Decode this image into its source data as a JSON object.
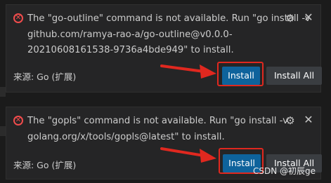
{
  "notifications": [
    {
      "message_lines": [
        "The \"go-outline\" command is not available. Run \"go install -v",
        "github.com/ramya-rao-a/go-outline@v0.0.0-",
        "20210608161538-9736a4bde949\" to install."
      ],
      "source": "来源: Go (扩展)",
      "install_label": "Install",
      "install_all_label": "Install All"
    },
    {
      "message_lines": [
        "The \"gopls\" command is not available. Run \"go install -v",
        "golang.org/x/tools/gopls@latest\" to install."
      ],
      "source": "来源: Go (扩展)",
      "install_label": "Install",
      "install_all_label": "Install All"
    }
  ],
  "watermark": "CSDN @初辰ge",
  "colors": {
    "error": "#f14c4c",
    "primary_button": "#0e639c",
    "secondary_button": "#3a3d41",
    "highlight": "#e0281f"
  },
  "icons": [
    "error-icon",
    "gear-icon",
    "close-icon"
  ]
}
